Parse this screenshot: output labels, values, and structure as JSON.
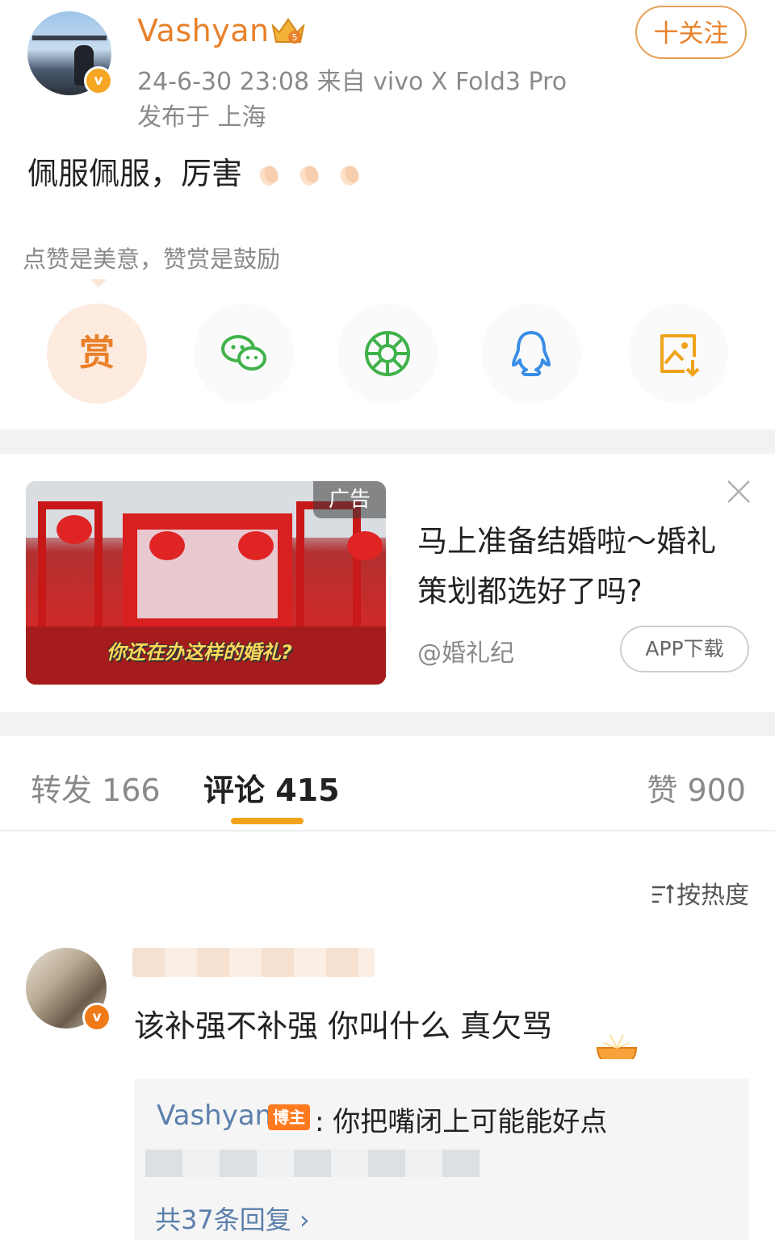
{
  "post": {
    "author": "Vashyan",
    "member_level": "5",
    "time_device": "24-6-30 23:08  来自 vivo X Fold3 Pro",
    "location": "发布于 上海",
    "follow_label": "十关注",
    "text": "佩服佩服，厉害"
  },
  "reward": {
    "tip": "点赞是美意，赞赏是鼓励",
    "button_label": "赏"
  },
  "share_icons": [
    "wechat-icon",
    "moments-icon",
    "qq-icon",
    "save-image-icon"
  ],
  "ad": {
    "tag": "广告",
    "image_caption": "你还在办这样的婚礼?",
    "title": "马上准备结婚啦～婚礼策划都选好了吗?",
    "source": "@婚礼纪",
    "download_label": "APP下载"
  },
  "tabs": {
    "repost": "转发 166",
    "comment": "评论 415",
    "like": "赞 900"
  },
  "sort_label": "按热度",
  "comment": {
    "text": "该补强不补强 你叫什么 真欠骂",
    "reply": {
      "author": "Vashyan",
      "badge": "博主",
      "text": ": 你把嘴闭上可能能好点"
    },
    "more_replies": "共37条回复 ›"
  },
  "colors": {
    "accent": "#e8812a",
    "tab_underline": "#f0a31a",
    "link_blue": "#5b7fab",
    "wechat_green": "#3fb24a"
  }
}
